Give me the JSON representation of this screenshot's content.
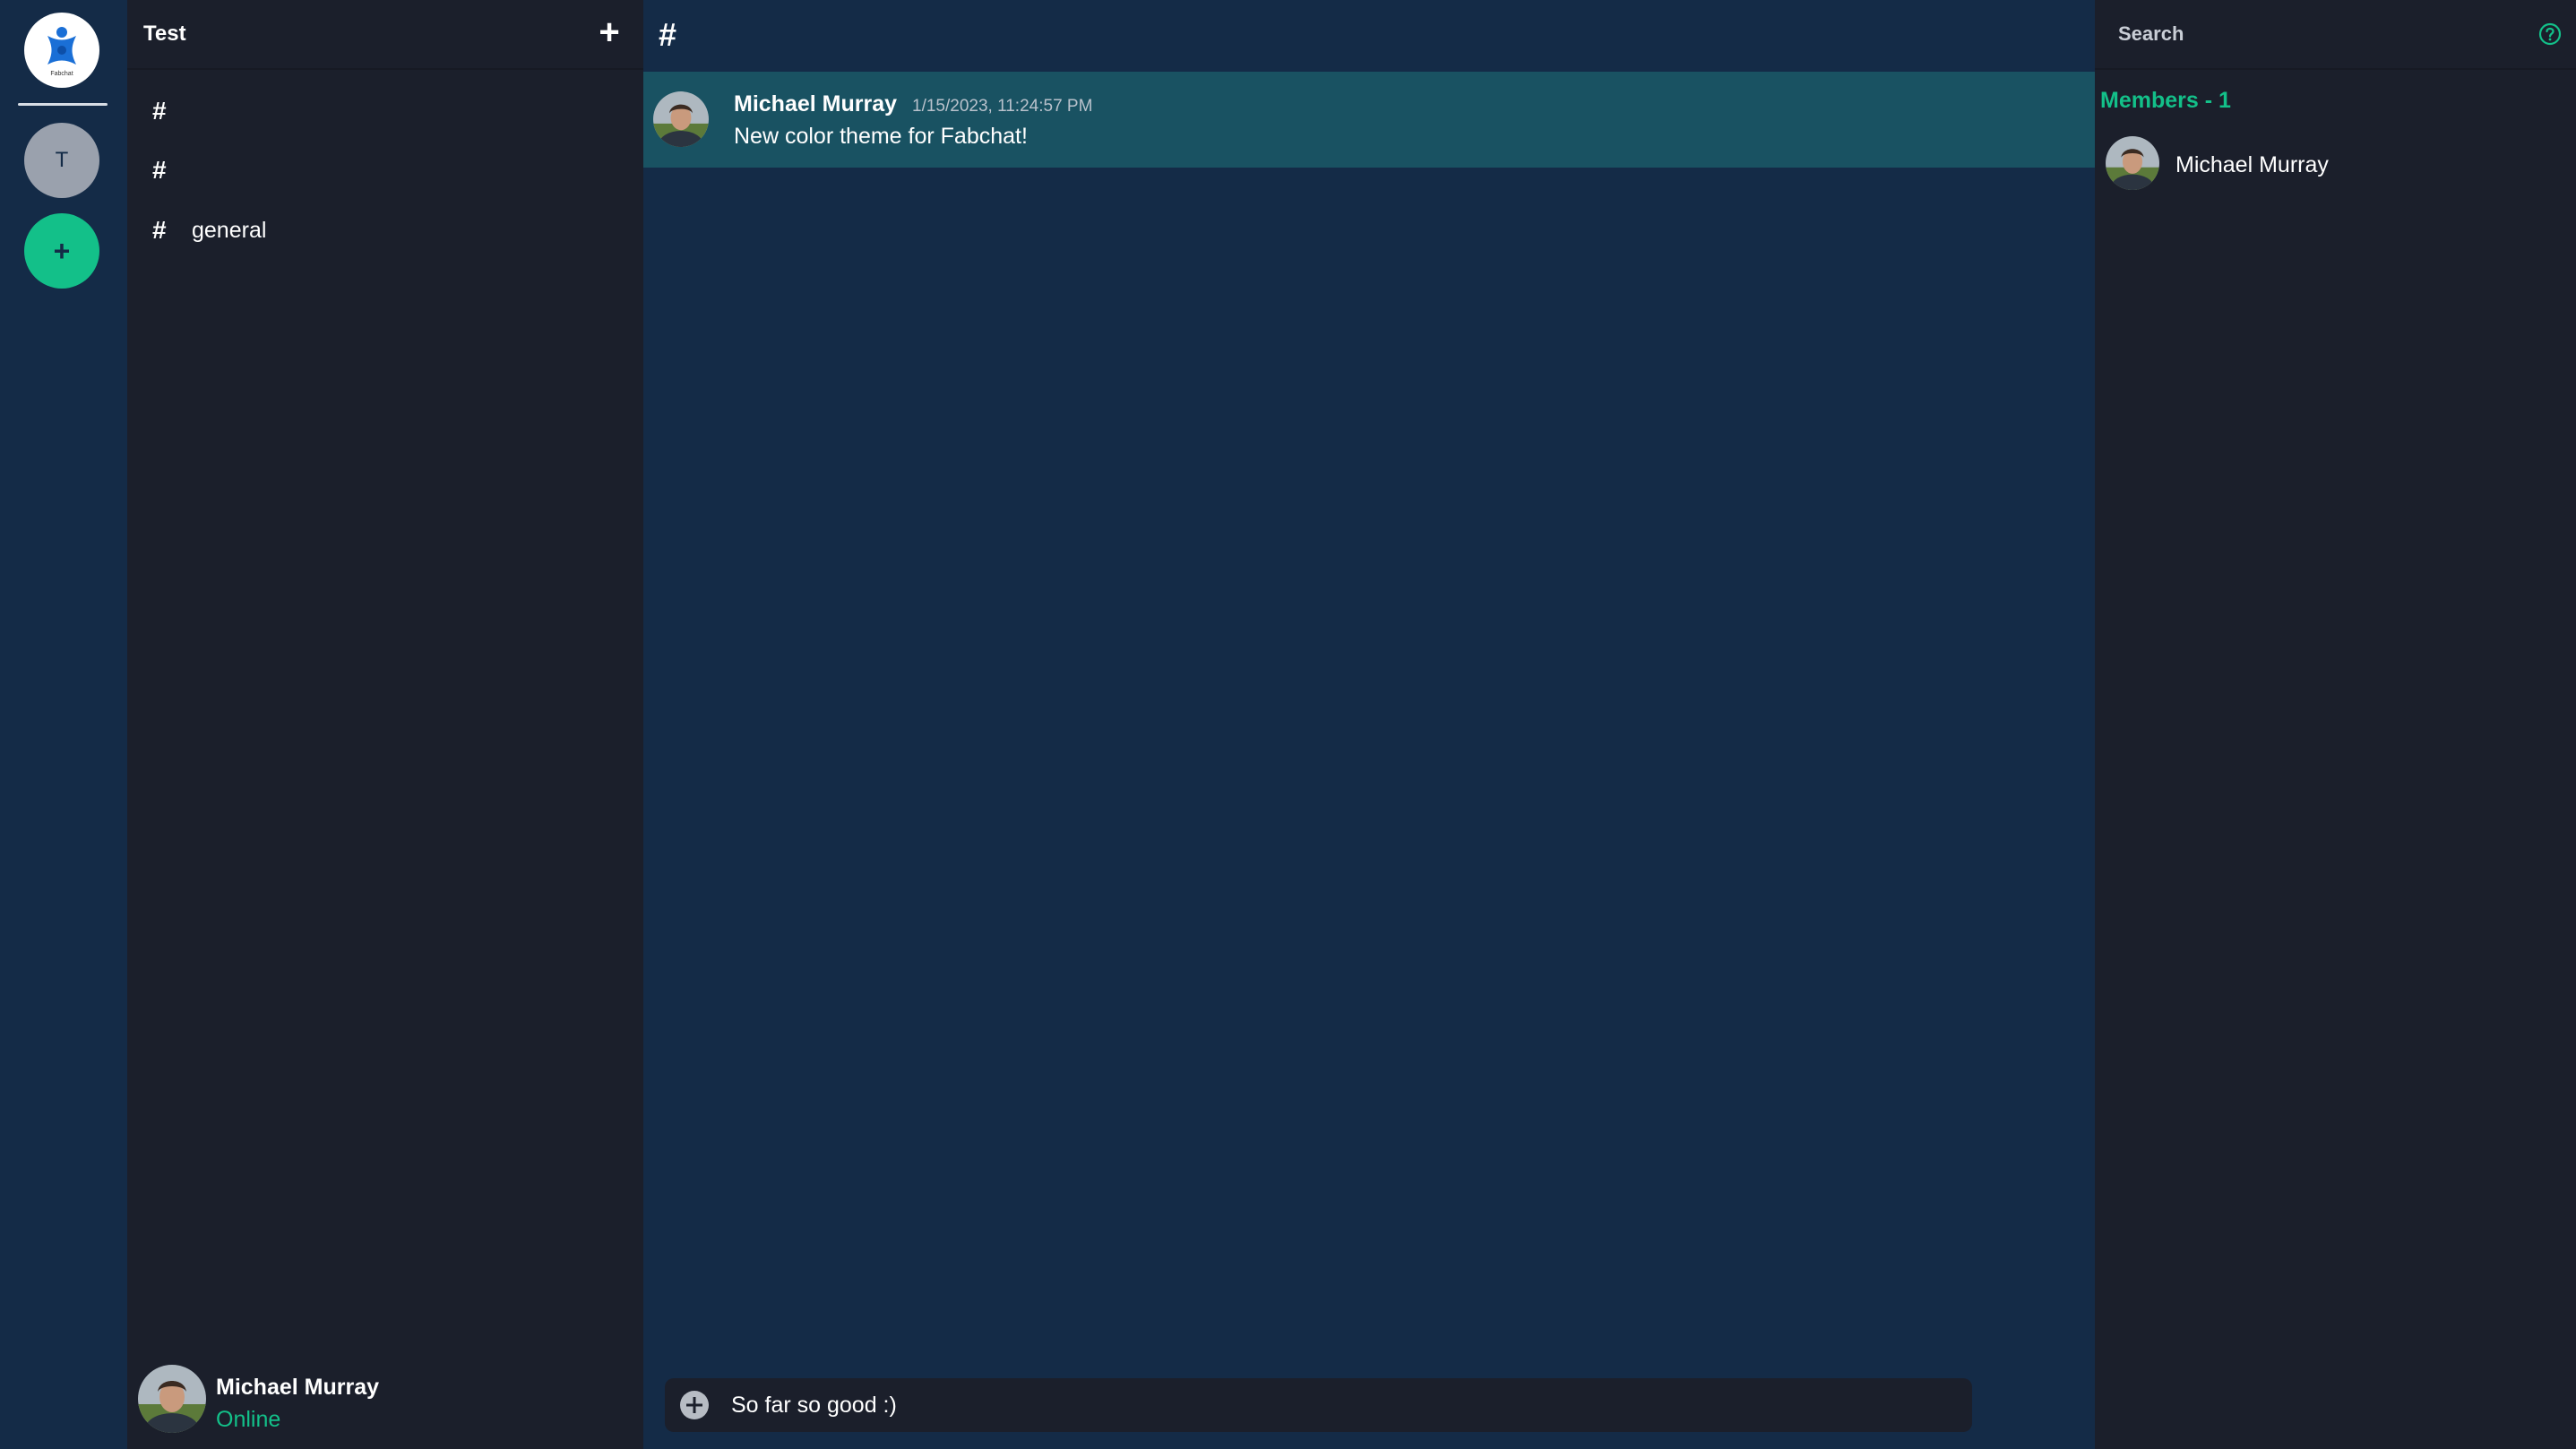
{
  "server_rail": {
    "logo_caption": "Fabchat",
    "servers": [
      {
        "initial": "T"
      }
    ],
    "add_server_label": "+"
  },
  "sidebar": {
    "server_name": "Test",
    "add_channel_label": "+",
    "channels": [
      {
        "hash": "#",
        "name": ""
      },
      {
        "hash": "#",
        "name": ""
      },
      {
        "hash": "#",
        "name": "general"
      }
    ]
  },
  "user_panel": {
    "name": "Michael Murray",
    "status": "Online"
  },
  "chat": {
    "header_hash": "#",
    "messages": [
      {
        "author": "Michael Murray",
        "timestamp": "1/15/2023, 11:24:57 PM",
        "text": "New color theme for Fabchat!"
      }
    ],
    "composer_value": "So far so good :)"
  },
  "members": {
    "search_placeholder": "Search",
    "title": "Members - 1",
    "list": [
      {
        "name": "Michael Murray"
      }
    ]
  },
  "colors": {
    "accent": "#13c089",
    "main_bg": "#142b47",
    "panel_bg": "#1b1f2b",
    "highlight_bg": "#195262"
  }
}
